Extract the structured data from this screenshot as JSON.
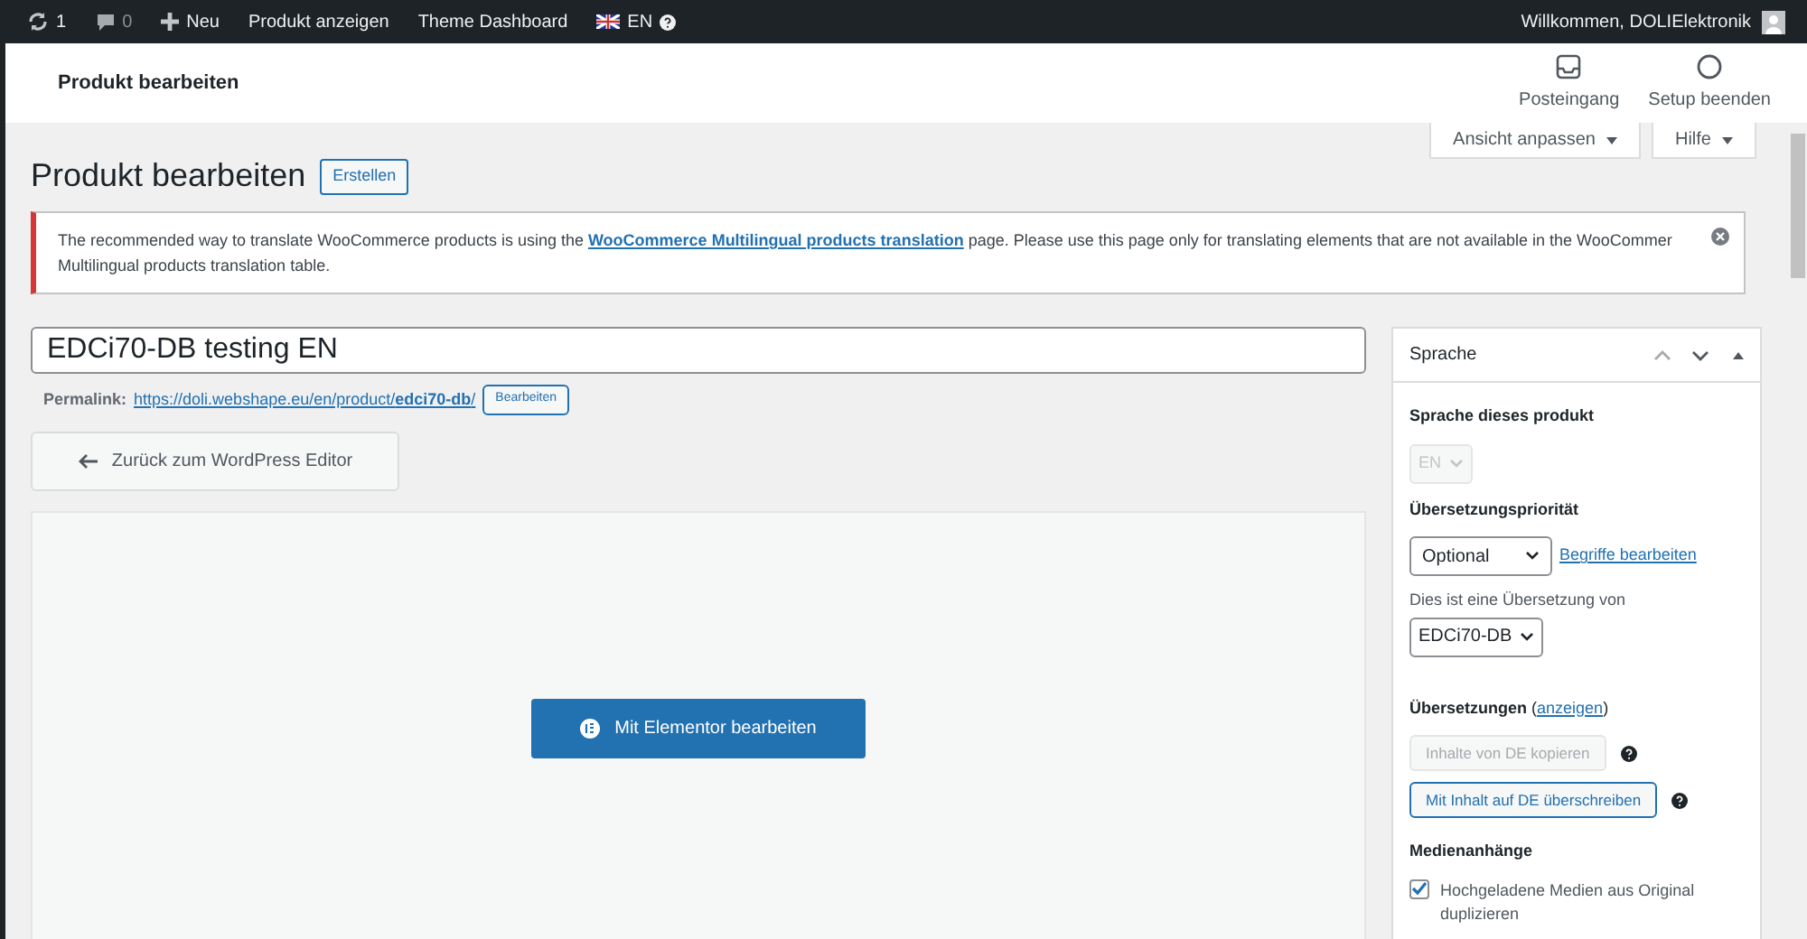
{
  "admin_bar": {
    "updates": "1",
    "comments": "0",
    "new": "Neu",
    "links": [
      "Produkt anzeigen",
      "Theme Dashboard"
    ],
    "language": "EN",
    "greeting": "Willkommen, DOLIElektronik"
  },
  "header": {
    "title": "Produkt bearbeiten",
    "actions": [
      {
        "kind": "inbox",
        "label": "Posteingang"
      },
      {
        "kind": "circle",
        "label": "Setup beenden"
      }
    ]
  },
  "screen_tabs": [
    "Ansicht anpassen",
    "Hilfe"
  ],
  "page": {
    "title": "Produkt bearbeiten",
    "add_button": "Erstellen"
  },
  "notice": {
    "before": "The recommended way to translate WooCommerce products is using the ",
    "link": "WooCommerce Multilingual products translation",
    "after": " page. Please use this page only for translating elements that are not available in the WooCommer",
    "line2": "Multilingual products translation table."
  },
  "post_title": "EDCi70-DB testing EN",
  "permalink": {
    "label": "Permalink:",
    "url_start": "https://doli.webshape.eu/en/product/",
    "slug": "edci70-db",
    "url_end": "/",
    "button": "Bearbeiten"
  },
  "back_button": "Zurück zum WordPress Editor",
  "elementor_button": "Mit Elementor bearbeiten",
  "language_box": {
    "title": "Sprache",
    "language_label": "Sprache dieses produkt",
    "language": "EN",
    "language_disabled": true,
    "priority_label": "Übersetzungspriorität",
    "priority": "Optional",
    "terms_link": "Begriffe bearbeiten",
    "translation_of_label": "Dies ist eine Übersetzung von",
    "translation_of": "EDCi70-DB",
    "translations_label": "**Übersetzungen** (",
    "translations_link": "anzeigen",
    "translations_after": ")",
    "buttons": [
      {
        "label": "Inhalte von DE kopieren",
        "disabled": true
      },
      {
        "label": "Mit Inhalt auf DE überschreiben",
        "disabled": false
      }
    ],
    "media_label": "Medienanhänge",
    "media_checkbox": {
      "label": "Hochgeladene Medien aus Original duplizieren",
      "checked": true
    }
  }
}
